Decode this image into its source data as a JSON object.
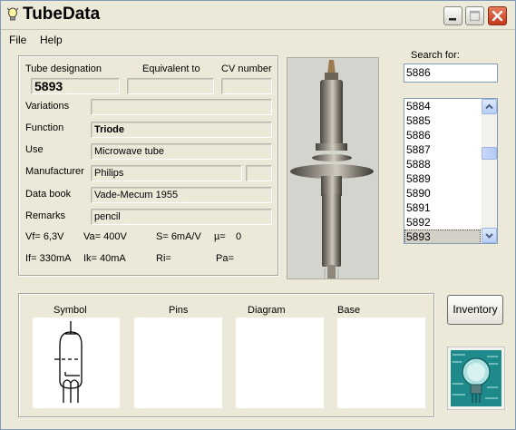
{
  "app": {
    "title": "TubeData"
  },
  "menu": {
    "file": "File",
    "help": "Help"
  },
  "details": {
    "designation_label": "Tube designation",
    "equivalent_label": "Equivalent to",
    "cv_label": "CV number",
    "designation": "5893",
    "equivalent": "",
    "cv_number": "",
    "variations_label": "Variations",
    "variations": "",
    "function_label": "Function",
    "function": "Triode",
    "use_label": "Use",
    "use": "Microwave tube",
    "manufacturer_label": "Manufacturer",
    "manufacturer": "Philips",
    "manufacturer_extra": "",
    "databook_label": "Data book",
    "databook": "Vade-Mecum 1955",
    "remarks_label": "Remarks",
    "remarks": "pencil"
  },
  "params": {
    "vf": "Vf= 6,3V",
    "va": "Va= 400V",
    "s": "S= 6mA/V",
    "mu": "µ=",
    "mu_value": "0",
    "if": "If= 330mA",
    "ik": "Ik= 40mA",
    "ri": "Ri=",
    "pa": "Pa="
  },
  "search": {
    "label": "Search for:",
    "value": "5886",
    "list": [
      "5884",
      "5885",
      "5886",
      "5887",
      "5888",
      "5889",
      "5890",
      "5891",
      "5892",
      "5893"
    ],
    "selected": "5893",
    "scroll_position": 0.25
  },
  "panels": {
    "symbol": "Symbol",
    "pins": "Pins",
    "diagram": "Diagram",
    "base": "Base"
  },
  "inventory_label": "Inventory",
  "icons": {
    "app": "lightbulb-icon",
    "minimize": "minimize-icon",
    "maximize": "maximize-icon",
    "close": "close-icon",
    "scroll_up": "chevron-up-icon",
    "scroll_down": "chevron-down-icon"
  },
  "colors": {
    "close_button": "#c4381a",
    "logo_background": "#1f8a8c"
  }
}
